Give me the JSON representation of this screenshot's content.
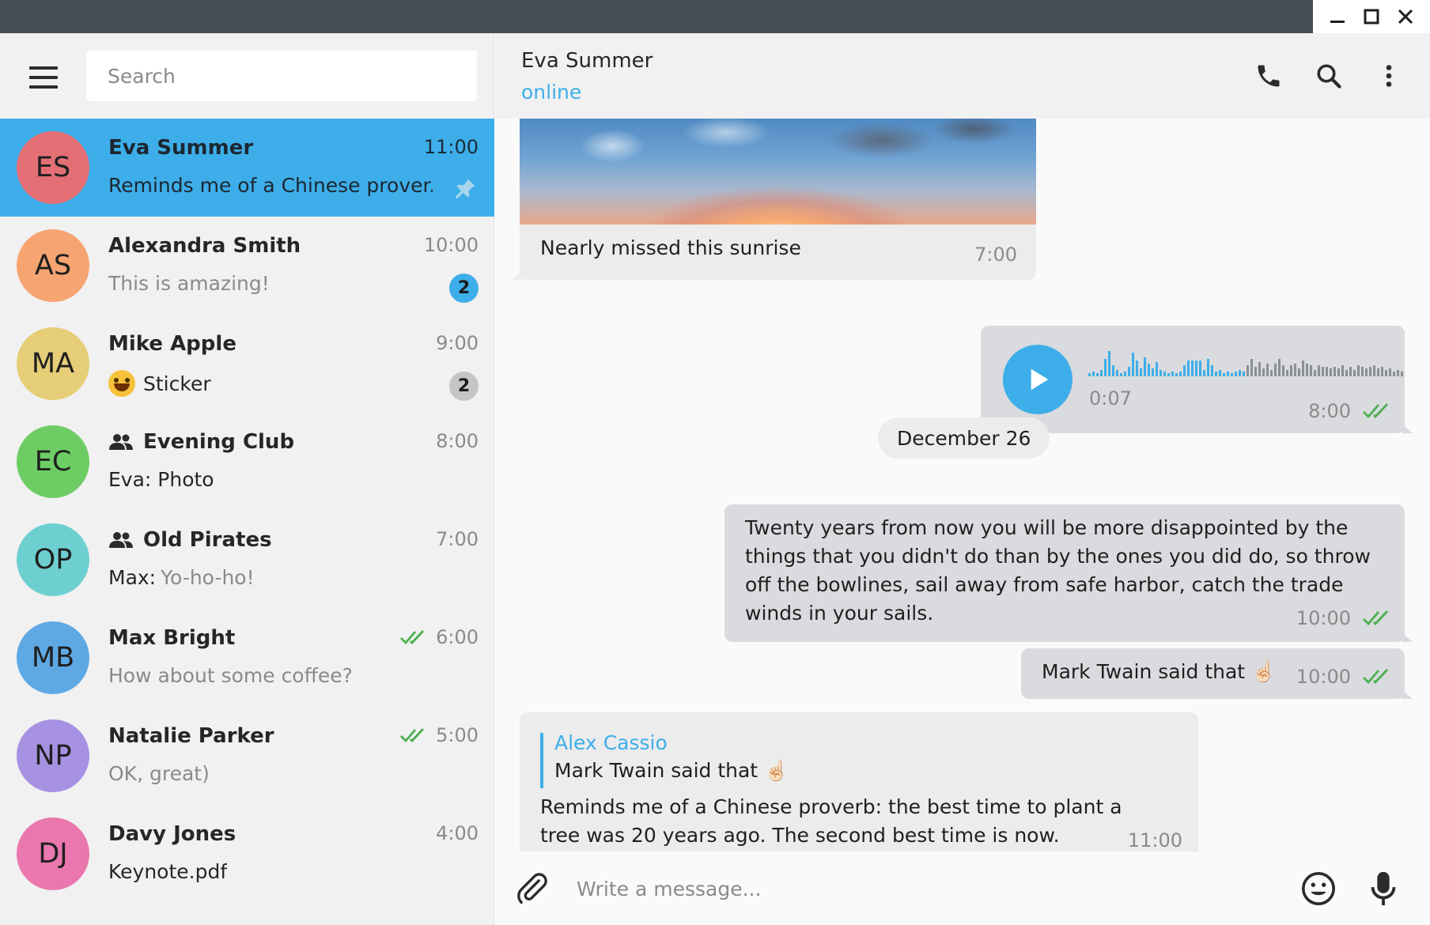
{
  "window": {
    "controls": [
      "minimize",
      "maximize",
      "close"
    ]
  },
  "sidebar": {
    "search_placeholder": "Search",
    "chats": [
      {
        "initials": "ES",
        "name": "Eva Summer",
        "time": "11:00",
        "preview": "Reminds me of a Chinese prover...",
        "avatar_color": "#e36f75",
        "active": true,
        "pinned": true
      },
      {
        "initials": "AS",
        "name": "Alexandra Smith",
        "time": "10:00",
        "preview": "This is amazing!",
        "avatar_color": "#f6a471",
        "badge": "2",
        "badge_style": "blue"
      },
      {
        "initials": "MA",
        "name": "Mike Apple",
        "time": "9:00",
        "preview": "Sticker",
        "preview_emoji": "😄",
        "avatar_color": "#e6cd77",
        "badge": "2",
        "badge_style": "gray"
      },
      {
        "initials": "EC",
        "name": "Evening Club",
        "group": true,
        "time": "8:00",
        "preview": "Eva: Photo",
        "avatar_color": "#6dcd64"
      },
      {
        "initials": "OP",
        "name": "Old Pirates",
        "group": true,
        "time": "7:00",
        "preview_sender": "Max:",
        "preview": "Yo-ho-ho!",
        "avatar_color": "#6ecfd0"
      },
      {
        "initials": "MB",
        "name": "Max Bright",
        "time": "6:00",
        "read": true,
        "preview": "How about some coffee?",
        "avatar_color": "#5ea8e4"
      },
      {
        "initials": "NP",
        "name": "Natalie Parker",
        "time": "5:00",
        "read": true,
        "preview": "OK, great)",
        "avatar_color": "#a791e3"
      },
      {
        "initials": "DJ",
        "name": "Davy Jones",
        "time": "4:00",
        "preview": "Keynote.pdf",
        "avatar_color": "#ea77ad"
      }
    ]
  },
  "chat": {
    "title": "Eva Summer",
    "status": "online",
    "messages": {
      "photo_caption": "Nearly missed this sunrise",
      "photo_time": "7:00",
      "voice_duration": "0:07",
      "voice_time": "8:00",
      "date_separator": "December 26",
      "quote_text": "Twenty years from now you will be more disappointed by the things that you didn't do than by the ones you did do, so throw off the bowlines, sail away from safe harbor, catch the trade winds in your sails.",
      "quote_time": "10:00",
      "twain_text": "Mark Twain said that",
      "twain_emoji": "☝🏻",
      "twain_time": "10:00",
      "reply_author": "Alex Cassio",
      "reply_quote": "Mark Twain said that",
      "reply_quote_emoji": "☝🏻",
      "reply_text": "Reminds me of a Chinese proverb: the best time to plant a tree was 20 years ago. The second best time is now.",
      "reply_time": "11:00"
    }
  },
  "composer": {
    "placeholder": "Write a message..."
  },
  "colors": {
    "accent": "#3daee9",
    "read_check": "#4caf50",
    "titlebar": "#474e58"
  }
}
